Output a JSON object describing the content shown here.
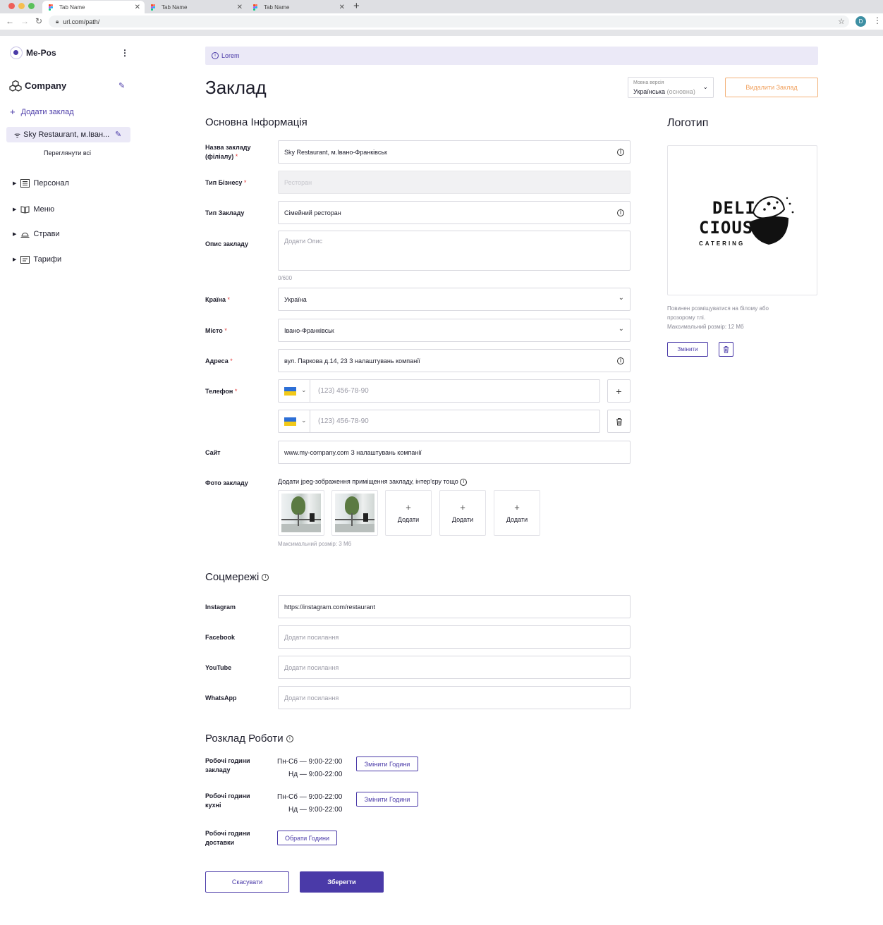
{
  "browser": {
    "tabs": [
      {
        "title": "Tab Name",
        "active": true
      },
      {
        "title": "Tab Name",
        "active": false
      },
      {
        "title": "Tab Name",
        "active": false
      }
    ],
    "url": "url.com/path/",
    "profile_initial": "D"
  },
  "sidebar": {
    "brand": "Me-Pos",
    "company": "Company",
    "add_venue": "Додати заклад",
    "selected_venue": "Sky Restaurant, м.Іван...",
    "view_all": "Переглянути всі",
    "nav": [
      {
        "label": "Персонал",
        "icon": "staff-icon"
      },
      {
        "label": "Меню",
        "icon": "book-icon"
      },
      {
        "label": "Страви",
        "icon": "cloche-icon"
      },
      {
        "label": "Тарифи",
        "icon": "tariff-icon"
      }
    ]
  },
  "banner": "Lorem",
  "page": {
    "title": "Заклад",
    "language": {
      "caption": "Мовна версія",
      "value": "Українська",
      "suffix": "(основна)"
    },
    "delete_label": "Видалити Заклад"
  },
  "basic": {
    "title": "Основна Інформація",
    "name_label_1": "Назва закладу",
    "name_label_2": "(філіалу)",
    "name_value": "Sky Restaurant, м.Івано-Франківськ",
    "business_type_label": "Тип Бізнесу",
    "business_type_value": "Ресторан",
    "venue_type_label": "Тип Закладу",
    "venue_type_value": "Сімейний ресторан",
    "description_label": "Опис закладу",
    "description_placeholder": "Додати Опис",
    "description_counter": "0/600",
    "country_label": "Країна",
    "country_value": "Україна",
    "city_label": "Місто",
    "city_value": "Івано-Франківськ",
    "address_label": "Адреса",
    "address_value": "вул. Паркова д.14, 23 З налаштувань компанії",
    "phone_label": "Телефон",
    "phone_placeholder": "(123) 456-78-90",
    "site_label": "Сайт",
    "site_value": "www.my-company.com З налаштувань компанії",
    "photo_label": "Фото закладу",
    "photo_hint": "Додати jpeg-зображення приміщення закладу, інтер'єру тощо",
    "photo_add": "Додати",
    "photo_max": "Максимальний розмір: 3 Мб"
  },
  "social": {
    "title": "Соцмережі",
    "instagram_label": "Instagram",
    "instagram_value": "https://instagram.com/restaurant",
    "facebook_label": "Facebook",
    "youtube_label": "YouTube",
    "whatsapp_label": "WhatsApp",
    "link_placeholder": "Додати посилання"
  },
  "schedule": {
    "title": "Розклад Роботи",
    "venue_label_1": "Робочі години",
    "venue_label_2": "закладу",
    "kitchen_label_1": "Робочі години",
    "kitchen_label_2": "кухні",
    "delivery_label_1": "Робочі години",
    "delivery_label_2": "доставки",
    "weekdays": "Пн-Сб — 9:00-22:00",
    "sunday": "Нд — 9:00-22:00",
    "change_hours": "Змінити Години",
    "choose_hours": "Обрати Години"
  },
  "actions": {
    "cancel": "Скасувати",
    "save": "Зберегти"
  },
  "logo": {
    "title": "Логотип",
    "line1": "DELI",
    "line2": "CIOUS",
    "line3": "CATERING",
    "hint_1": "Повинен розміщуватися на білому або",
    "hint_2": "прозорому тлі.",
    "hint_3": "Максимальний розмір: 12 Мб",
    "change": "Змінити"
  },
  "colors": {
    "accent": "#4a3aa8",
    "danger": "#f0a15e",
    "required": "#e23c3c"
  }
}
